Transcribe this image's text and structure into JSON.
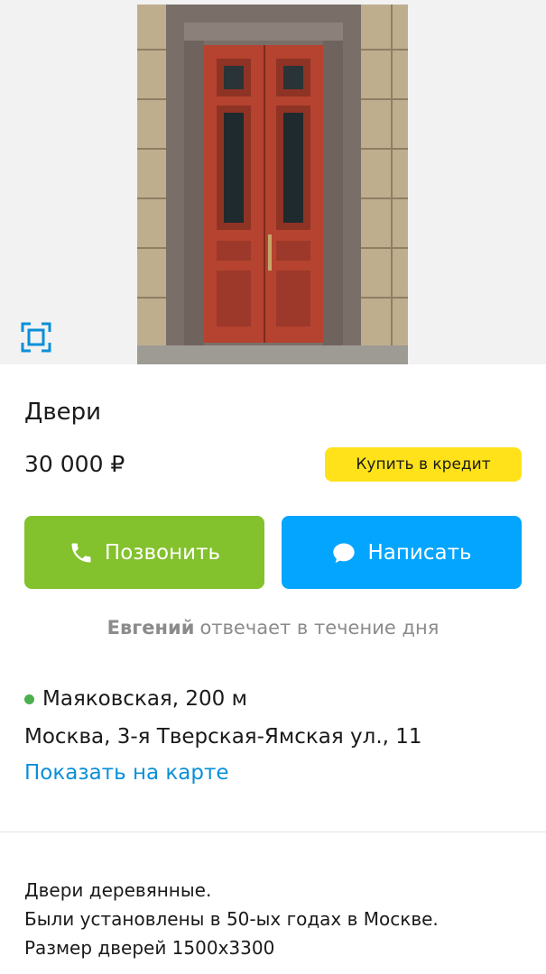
{
  "listing": {
    "title": "Двери",
    "price": "30 000 ₽",
    "credit_label": "Купить в кредит"
  },
  "actions": {
    "call_label": "Позвонить",
    "write_label": "Написать"
  },
  "seller": {
    "name": "Евгений",
    "response": "отвечает в течение дня"
  },
  "location": {
    "metro": "Маяковская, 200 м",
    "address": "Москва, 3-я Тверская-Ямская ул., 11",
    "map_link": "Показать на карте"
  },
  "description": {
    "lines": [
      "Двери деревянные.",
      "Были установлены в 50-ых годах в Москве.",
      "Размер дверей 1500х3300"
    ]
  },
  "colors": {
    "call_button": "#83c12d",
    "write_button": "#04a5ff",
    "credit_button": "#ffe21a",
    "link": "#0a8fd8",
    "metro_dot": "#4caf50"
  },
  "icons": {
    "fullscreen": "fullscreen-icon",
    "phone": "phone-icon",
    "chat": "chat-bubble-icon"
  }
}
